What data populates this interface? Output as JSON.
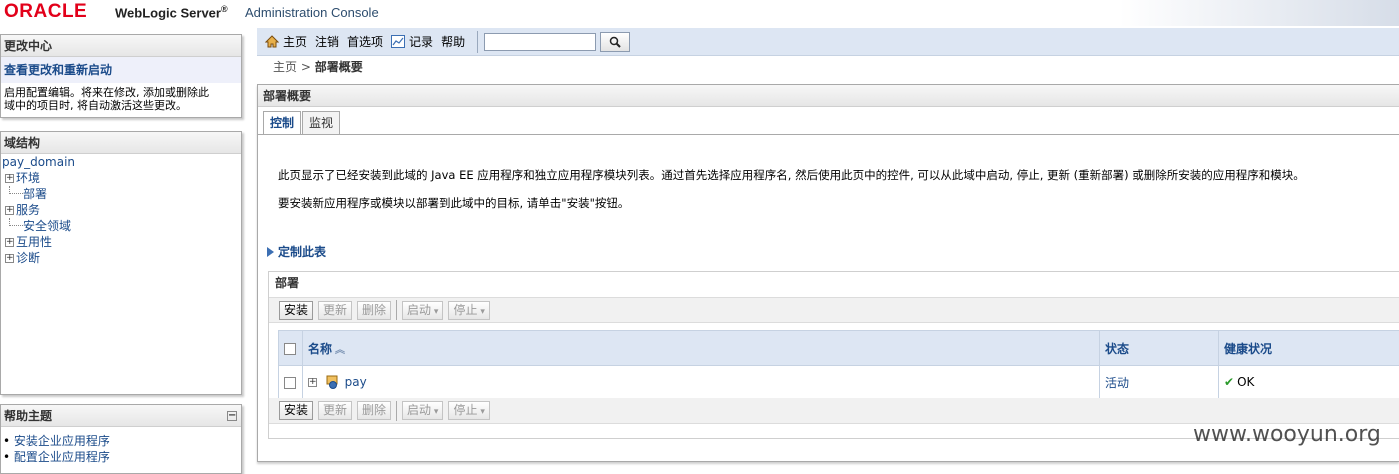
{
  "header": {
    "oracle": "ORACLE",
    "product": "WebLogic Server",
    "reg": "®",
    "console": "Administration Console"
  },
  "change_center": {
    "title": "更改中心",
    "link": "查看更改和重新启动",
    "desc_line1": "启用配置编辑。将来在修改, 添加或删除此",
    "desc_line2": "域中的项目时, 将自动激活这些更改。"
  },
  "domain_structure": {
    "title": "域结构",
    "root": "pay_domain",
    "items": [
      {
        "label": "环境",
        "expandable": true
      },
      {
        "label": "部署",
        "expandable": false
      },
      {
        "label": "服务",
        "expandable": true
      },
      {
        "label": "安全领域",
        "expandable": false
      },
      {
        "label": "互用性",
        "expandable": true
      },
      {
        "label": "诊断",
        "expandable": true
      }
    ]
  },
  "help_topics": {
    "title": "帮助主题",
    "items": [
      "安装企业应用程序",
      "配置企业应用程序"
    ]
  },
  "toolbar": {
    "home": "主页",
    "logout": "注销",
    "preferences": "首选项",
    "record": "记录",
    "help": "帮助",
    "search_value": ""
  },
  "breadcrumb": {
    "home": "主页",
    "separator": ">",
    "current": "部署概要"
  },
  "page": {
    "title": "部署概要",
    "tabs": [
      "控制",
      "监视"
    ],
    "intro1": "此页显示了已经安装到此域的 Java EE 应用程序和独立应用程序模块列表。通过首先选择应用程序名, 然后使用此页中的控件, 可以从此域中启动, 停止, 更新 (重新部署) 或删除所安装的应用程序和模块。",
    "intro2": "要安装新应用程序或模块以部署到此域中的目标, 请单击\"安装\"按钮。",
    "customize": "定制此表"
  },
  "deployments": {
    "title": "部署",
    "buttons": {
      "install": "安装",
      "update": "更新",
      "delete": "删除",
      "start": "启动",
      "stop": "停止"
    },
    "columns": {
      "name": "名称",
      "state": "状态",
      "health": "健康状况"
    },
    "rows": [
      {
        "name": "pay",
        "state": "活动",
        "health": "OK"
      }
    ]
  },
  "watermark": "www.wooyun.org",
  "colors": {
    "oracle_red": "#e2001a",
    "link_blue": "#1b4b8a",
    "toolbar_bg": "#dde6f3",
    "ok_green": "#2a9a2a"
  }
}
